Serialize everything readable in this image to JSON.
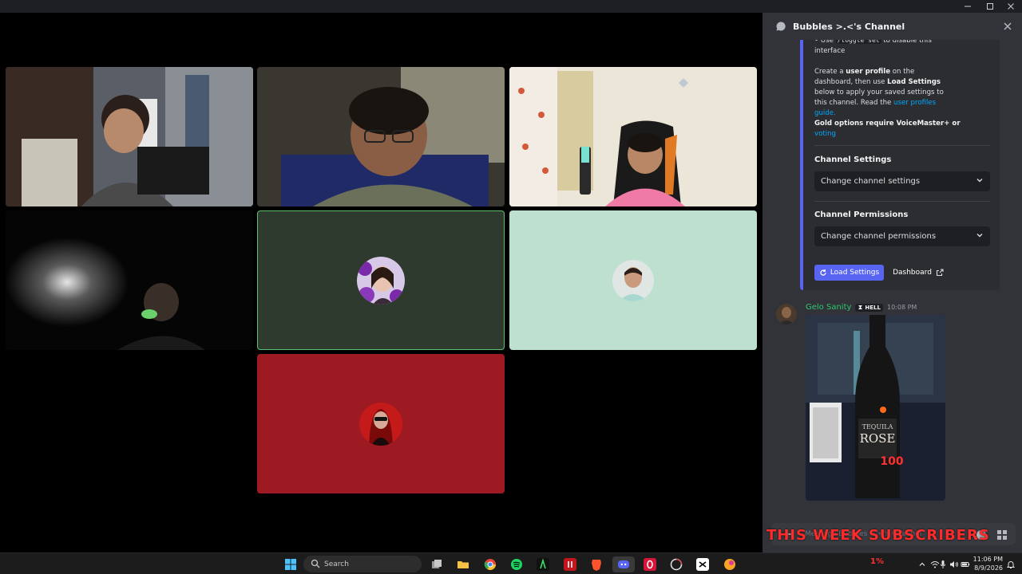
{
  "panel": {
    "title": "Bubbles >.<'s Channel",
    "embed": {
      "line1_pre": "• Use ",
      "line1_code": "/toggle set",
      "line1_post": " to disable this",
      "line2": "interface",
      "p2_a": "Create a ",
      "p2_b": "user profile",
      "p2_c": " on the",
      "p3_a": "dashboard, then use ",
      "p3_b": "Load Settings",
      "p4": "below to apply your saved settings to",
      "p5_a": "this channel. Read the ",
      "p5_b": "user profiles",
      "p6": "guide.",
      "p7": "Gold options require VoiceMaster+ or",
      "p8": "voting",
      "channel_settings_title": "Channel Settings",
      "channel_settings_select": "Change channel settings",
      "channel_permissions_title": "Channel Permissions",
      "channel_permissions_select": "Change channel permissions",
      "load_settings_label": "Load Settings",
      "dashboard_label": "Dashboard"
    },
    "message": {
      "author": "Gelo Sanity",
      "tag": "HELL",
      "time": "10:08 PM",
      "image_text_brand": "ROSE",
      "image_text_top": "TEQUILA",
      "image_overlay_value": "100"
    },
    "composer_placeholder": "Message Bubbles >.<'s Channel"
  },
  "overlay": {
    "banner": "THIS WEEK SUBSCRIBERS"
  },
  "taskbar": {
    "search_label": "Search",
    "tray_percent": "1%",
    "time": "11:06 PM",
    "date": "8/9/2026"
  },
  "colors": {
    "tile_dark": "#2f3a2f",
    "tile_mint": "#bde0cf",
    "tile_red": "#9e1a22",
    "author_green": "#2dc770",
    "blurple": "#5865f2"
  }
}
